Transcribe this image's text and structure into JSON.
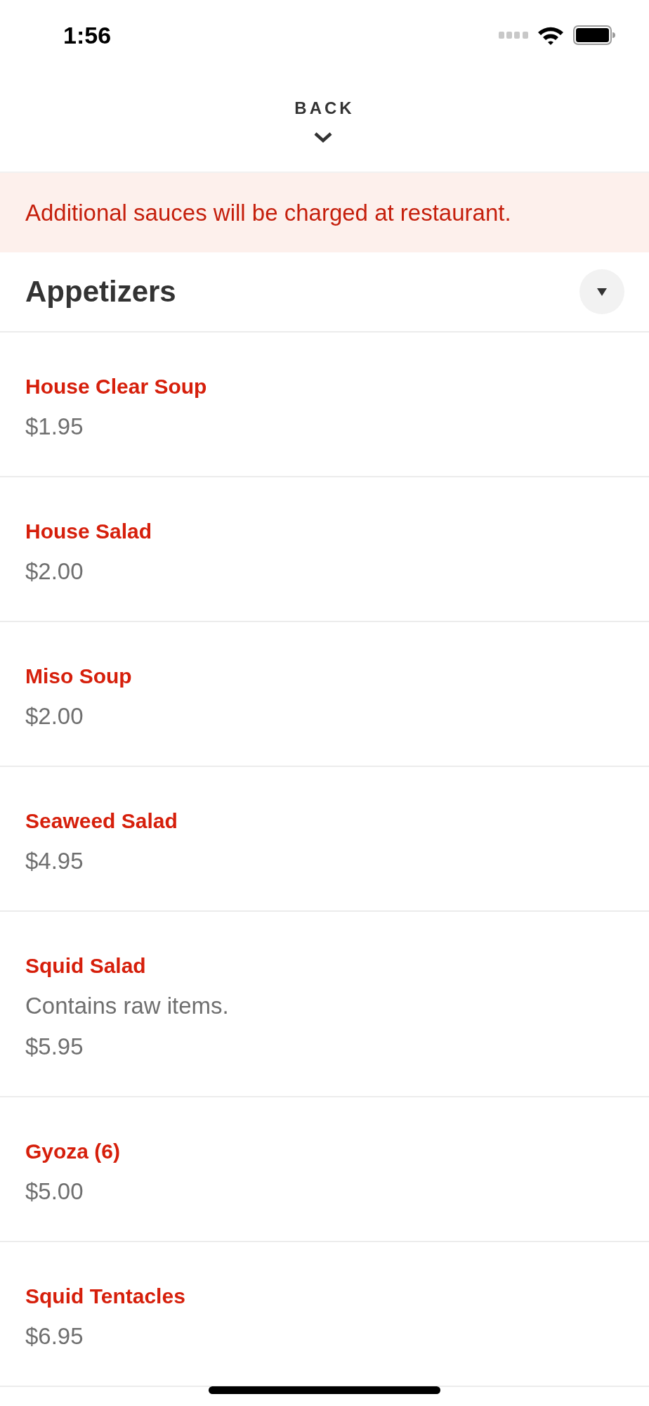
{
  "status_bar": {
    "time": "1:56"
  },
  "header": {
    "back_label": "BACK"
  },
  "notice": {
    "text": "Additional sauces will be charged at restaurant."
  },
  "section": {
    "title": "Appetizers"
  },
  "items": [
    {
      "name": "House Clear Soup",
      "price": "$1.95"
    },
    {
      "name": "House Salad",
      "price": "$2.00"
    },
    {
      "name": "Miso Soup",
      "price": "$2.00"
    },
    {
      "name": "Seaweed Salad",
      "price": "$4.95"
    },
    {
      "name": "Squid Salad",
      "description": "Contains raw items.",
      "price": "$5.95"
    },
    {
      "name": "Gyoza (6)",
      "price": "$5.00"
    },
    {
      "name": "Squid Tentacles",
      "price": "$6.95"
    }
  ]
}
